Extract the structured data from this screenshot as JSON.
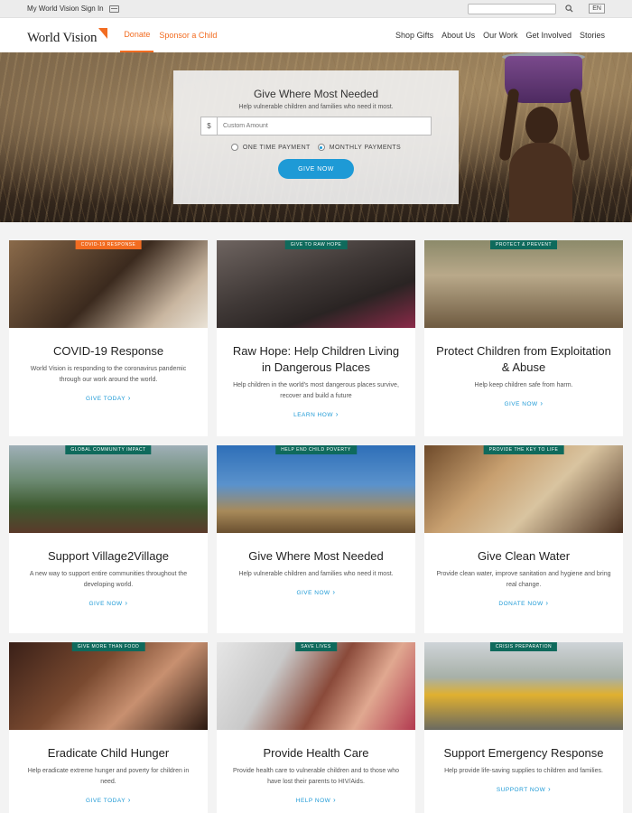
{
  "utility": {
    "signin_label": "My World Vision Sign In",
    "lang_label": "EN"
  },
  "nav": {
    "logo_text": "World Vision",
    "primary": [
      {
        "label": "Donate"
      },
      {
        "label": "Sponsor a Child"
      }
    ],
    "secondary": [
      {
        "label": "Shop Gifts"
      },
      {
        "label": "About Us"
      },
      {
        "label": "Our Work"
      },
      {
        "label": "Get Involved"
      },
      {
        "label": "Stories"
      }
    ]
  },
  "hero": {
    "title": "Give Where Most Needed",
    "subtitle": "Help vulnerable children and families who need it most.",
    "currency": "$",
    "amount_placeholder": "Custom Amount",
    "option_one_time": "ONE TIME PAYMENT",
    "option_monthly": "MONTHLY PAYMENTS",
    "selected_option": "monthly",
    "button_label": "GIVE NOW"
  },
  "colors": {
    "brand_orange": "#f26c21",
    "cta_blue": "#1e9ad6",
    "tag_teal": "#0f6a5c"
  },
  "cards": [
    {
      "tag": "COVID-19 RESPONSE",
      "tag_color": "orange",
      "title": "COVID-19 Response",
      "desc": "World Vision is responding to the coronavirus pandemic through our work around the world.",
      "cta": "GIVE TODAY"
    },
    {
      "tag": "GIVE TO RAW HOPE",
      "tag_color": "teal",
      "title": "Raw Hope: Help Children Living in Dangerous Places",
      "desc": "Help children in the world's most dangerous places survive, recover and build a future",
      "cta": "LEARN HOW"
    },
    {
      "tag": "PROTECT & PREVENT",
      "tag_color": "teal",
      "title": "Protect Children from Exploitation & Abuse",
      "desc": "Help keep children safe from harm.",
      "cta": "GIVE NOW"
    },
    {
      "tag": "GLOBAL COMMUNITY IMPACT",
      "tag_color": "teal",
      "title": "Support Village2Village",
      "desc": "A new way to support entire communities throughout the developing world.",
      "cta": "GIVE NOW"
    },
    {
      "tag": "HELP END CHILD POVERTY",
      "tag_color": "teal",
      "title": "Give Where Most Needed",
      "desc": "Help vulnerable children and families who need it most.",
      "cta": "GIVE NOW"
    },
    {
      "tag": "PROVIDE THE KEY TO LIFE",
      "tag_color": "teal",
      "title": "Give Clean Water",
      "desc": "Provide clean water, improve sanitation and hygiene and bring real change.",
      "cta": "DONATE NOW"
    },
    {
      "tag": "GIVE MORE THAN FOOD",
      "tag_color": "teal",
      "title": "Eradicate Child Hunger",
      "desc": "Help eradicate extreme hunger and poverty for children in need.",
      "cta": "GIVE TODAY"
    },
    {
      "tag": "SAVE LIVES",
      "tag_color": "teal",
      "title": "Provide Health Care",
      "desc": "Provide health care to vulnerable children and to those who have lost their parents to HIV/Aids.",
      "cta": "HELP NOW"
    },
    {
      "tag": "CRISIS PREPARATION",
      "tag_color": "teal",
      "title": "Support Emergency Response",
      "desc": "Help provide life-saving supplies to children and families.",
      "cta": "SUPPORT NOW"
    }
  ]
}
